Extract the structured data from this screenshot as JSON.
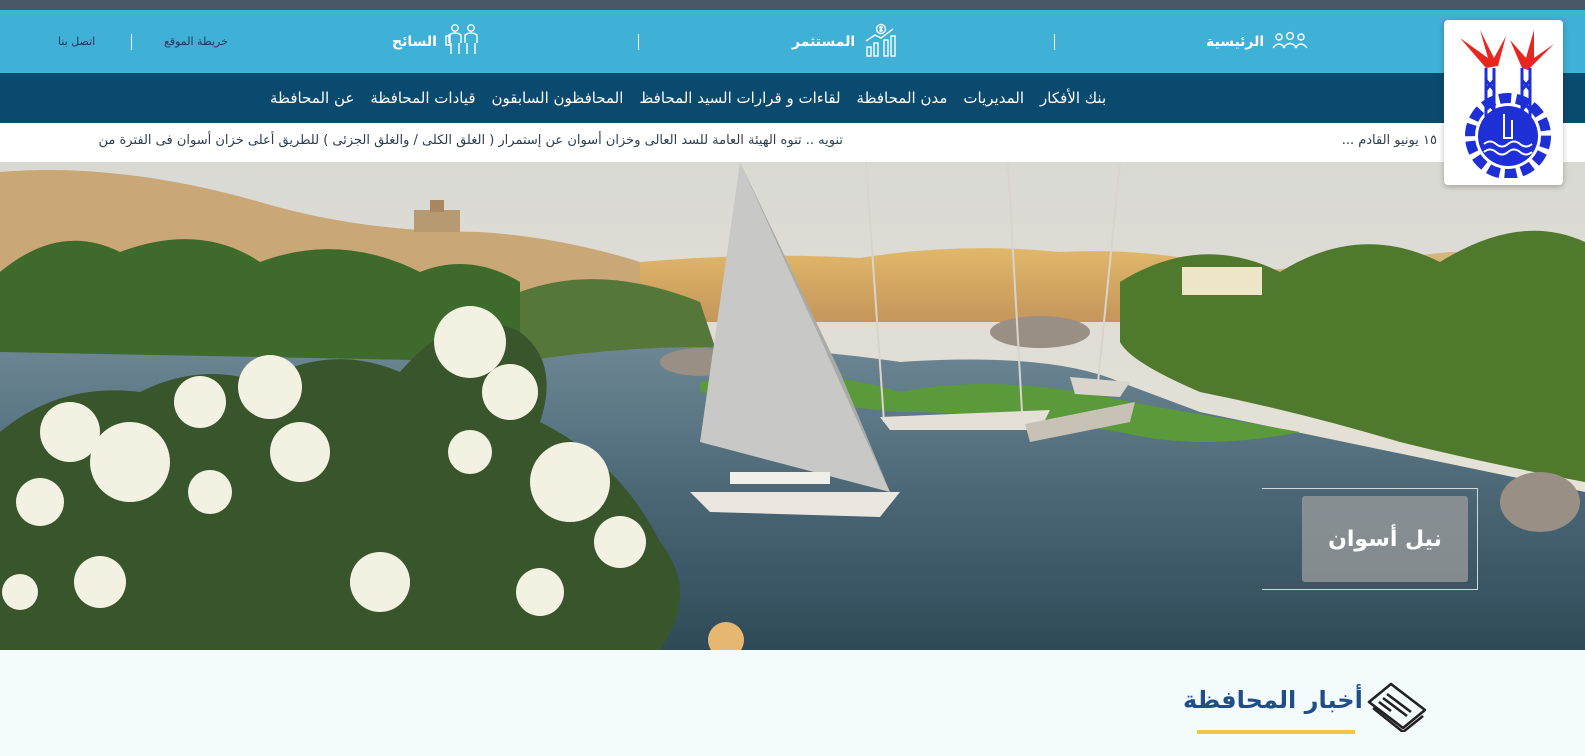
{
  "top_bar": {
    "home": "الرئيسية",
    "investor": "المستثمر",
    "tourist": "السائح",
    "sitemap": "خريطة الموقع",
    "contact": "اتصل بنا"
  },
  "nav": {
    "items": [
      "عن المحافظة",
      "قيادات المحافظة",
      "المحافظون السابقون",
      "لقاءات و قرارات السيد المحافظ",
      "مدن المحافظة",
      "المديريات",
      "بنك الأفكار"
    ]
  },
  "ticker": {
    "news_1": "تنويه .. تنوه الهيئة العامة للسد العالى وخزان أسوان عن إستمرار ( الغلق الكلى / والغلق الجزئى ) للطريق أعلى خزان أسوان فى الفترة من",
    "news_2": "١٥ يونيو القادم ..."
  },
  "hero": {
    "caption": "نيل أسوان"
  },
  "news": {
    "title": "أخبار المحافظة"
  },
  "colors": {
    "top_bar": "#3fb0d6",
    "nav_bar": "#0b4a6f",
    "accent_underline": "#f2c542",
    "news_title": "#1f4f86"
  }
}
